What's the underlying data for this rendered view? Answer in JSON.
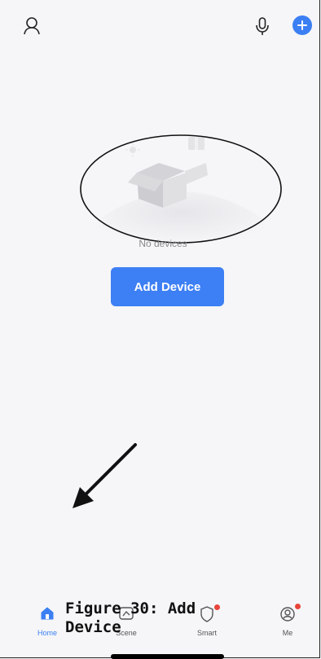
{
  "empty_state": {
    "message": "No devices",
    "button_label": "Add Device"
  },
  "tabs": [
    {
      "label": "Home",
      "icon": "home-icon",
      "active": true
    },
    {
      "label": "Scene",
      "icon": "scene-icon",
      "active": false
    },
    {
      "label": "Smart",
      "icon": "smart-icon",
      "active": false,
      "badge": true
    },
    {
      "label": "Me",
      "icon": "me-icon",
      "active": false,
      "badge": true
    }
  ],
  "caption": {
    "text": "Figure 30: Add Device"
  },
  "header_icons": [
    "user-icon",
    "microphone-icon",
    "plus-icon"
  ],
  "colors": {
    "accent": "#3d7ff4",
    "badge": "#e8443a",
    "background": "#f6f6f8"
  }
}
